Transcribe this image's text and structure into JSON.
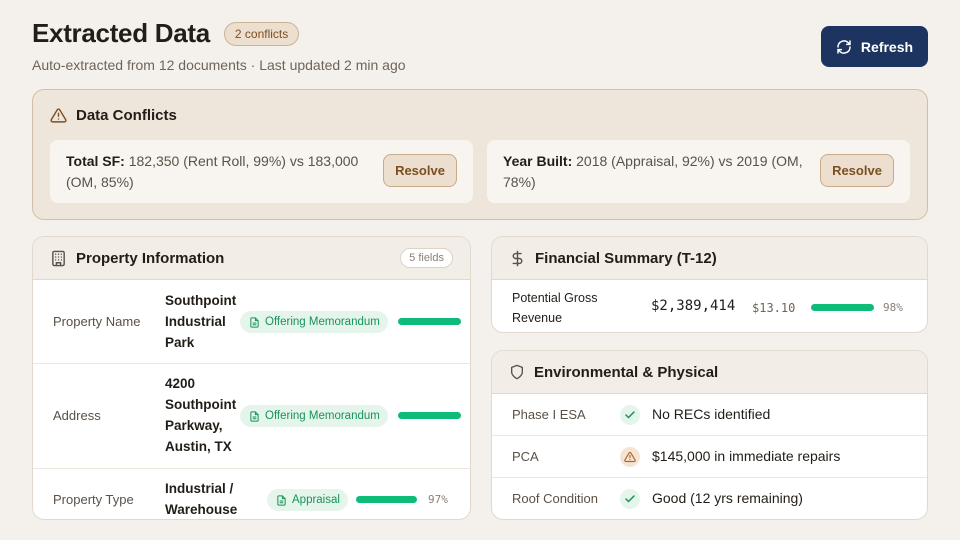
{
  "header": {
    "title": "Extracted Data",
    "conflict_badge": "2 conflicts",
    "subtitle": "Auto-extracted from 12 documents · Last updated 2 min ago",
    "refresh_label": "Refresh"
  },
  "conflicts": {
    "title": "Data Conflicts",
    "items": [
      {
        "field": "Total SF:",
        "detail": " 182,350 (Rent Roll, 99%) vs 183,000 (OM, 85%)",
        "action": "Resolve"
      },
      {
        "field": "Year Built:",
        "detail": " 2018 (Appraisal, 92%) vs 2019 (OM, 78%)",
        "action": "Resolve"
      }
    ]
  },
  "property": {
    "title": "Property Information",
    "fields_badge": "5 fields",
    "rows": [
      {
        "label": "Property Name",
        "value": "Southpoint Industrial Park",
        "source": "Offering Memorandum",
        "confidence": 100,
        "pct": ""
      },
      {
        "label": "Address",
        "value": "4200 Southpoint Parkway, Austin, TX",
        "source": "Offering Memorandum",
        "confidence": 100,
        "pct": ""
      },
      {
        "label": "Property Type",
        "value": "Industrial / Warehouse",
        "source": "Appraisal",
        "confidence": 97,
        "pct": "97%"
      }
    ]
  },
  "financial": {
    "title": "Financial Summary (T-12)",
    "rows": [
      {
        "label": "Potential Gross Revenue",
        "value": "$2,389,414",
        "per_sf": "$13.10",
        "confidence": 98,
        "pct": "98%"
      }
    ]
  },
  "environmental": {
    "title": "Environmental & Physical",
    "rows": [
      {
        "label": "Phase I ESA",
        "status": "ok",
        "value": "No RECs identified"
      },
      {
        "label": "PCA",
        "status": "warning",
        "value": "$145,000 in immediate repairs"
      },
      {
        "label": "Roof Condition",
        "status": "ok",
        "value": "Good (12 yrs remaining)"
      }
    ]
  },
  "colors": {
    "accent": "#1d3461",
    "success": "#0fbb79",
    "warning": "#b5652b",
    "background": "#f4f1ec"
  }
}
